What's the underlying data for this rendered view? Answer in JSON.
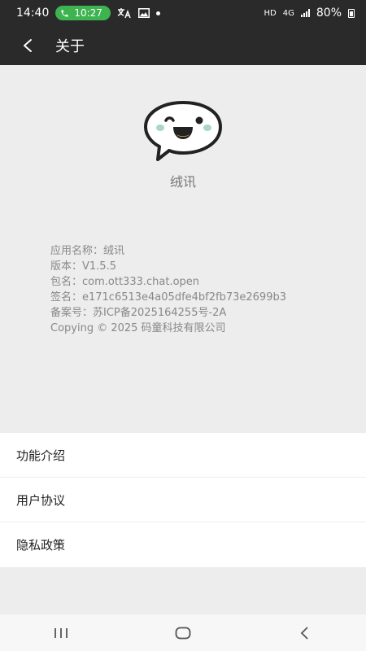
{
  "status_bar": {
    "time": "14:40",
    "call_timer": "10:27",
    "network_hd": "HD",
    "network_4g": "4G",
    "battery": "80%"
  },
  "header": {
    "title": "关于"
  },
  "about": {
    "app_name": "绒讯",
    "info_lines": [
      "应用名称：绒讯",
      "版本：V1.5.5",
      "包名：com.ott333.chat.open",
      "签名：e171c6513e4a05dfe4bf2fb73e2699b3",
      "备案号：苏ICP备2025164255号-2A",
      "Copying © 2025 码童科技有限公司"
    ]
  },
  "menu": {
    "items": [
      {
        "label": "功能介绍"
      },
      {
        "label": "用户协议"
      },
      {
        "label": "隐私政策"
      }
    ]
  },
  "colors": {
    "header_bg": "#2a2a2a",
    "page_bg": "#ededed",
    "call_pill": "#3db44f"
  },
  "icons": {
    "back": "back-arrow-icon",
    "logo": "smiling-chat-bubble-logo",
    "nav_recents": "recents-icon",
    "nav_home": "home-icon",
    "nav_back": "nav-back-icon"
  }
}
